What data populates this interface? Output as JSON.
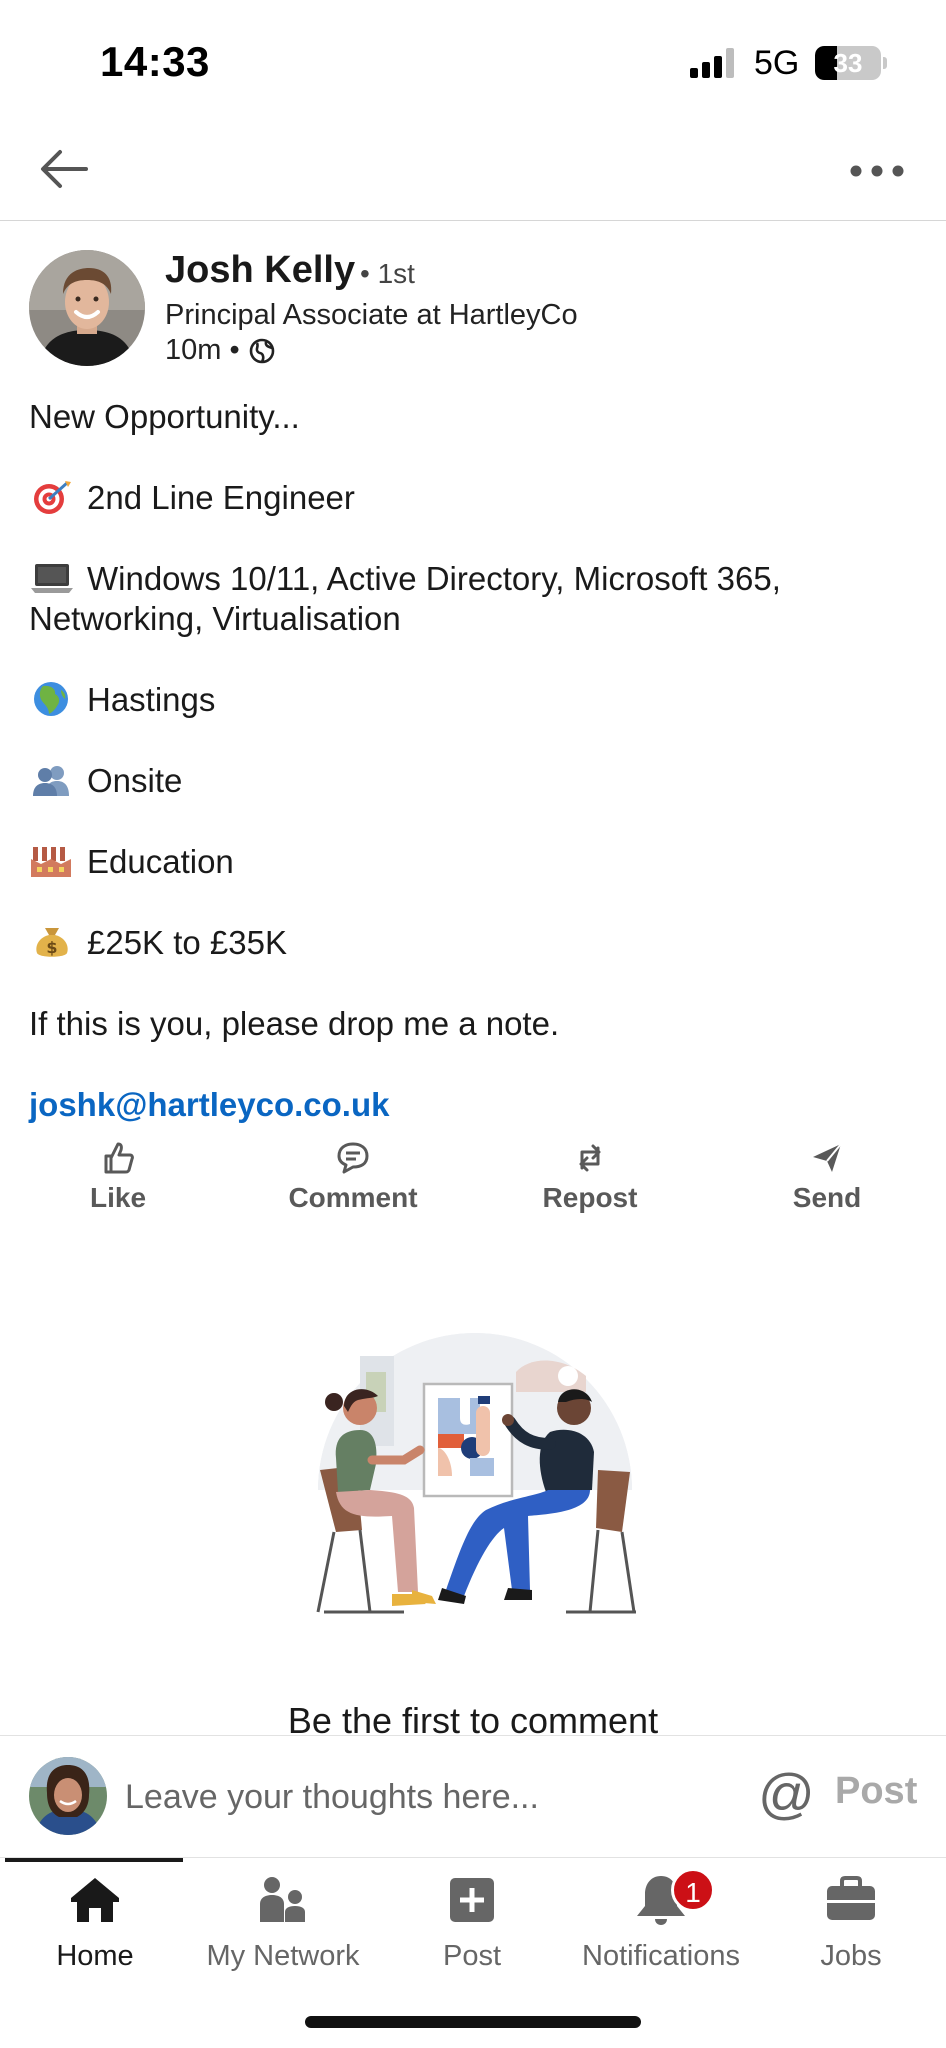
{
  "status_bar": {
    "time": "14:33",
    "network": "5G",
    "battery": "33",
    "battery_level": 0.33
  },
  "nav": {
    "back_icon": "arrow-left-icon",
    "more_icon": "ellipsis-icon"
  },
  "post": {
    "author": {
      "name": "Josh Kelly",
      "degree": "• 1st",
      "headline": "Principal Associate at HartleyCo",
      "time": "10m •",
      "visibility_icon": "globe-icon"
    },
    "lines": {
      "intro": "New Opportunity...",
      "role": "2nd Line Engineer",
      "skills_1": "Windows 10/11, Active Directory, Microsoft 365,",
      "skills_2": "Networking, Virtualisation",
      "location": "Hastings",
      "work_type": "Onsite",
      "sector": "Education",
      "salary": "£25K to £35K",
      "cta": "If this is you, please drop me a note.",
      "email": "joshk@hartleyco.co.uk"
    },
    "emojis": [
      "direct-hit-emoji",
      "laptop-emoji",
      "globe-africa-emoji",
      "busts-emoji",
      "factory-emoji",
      "money-bag-emoji"
    ]
  },
  "actions": {
    "like": "Like",
    "comment": "Comment",
    "repost": "Repost",
    "send": "Send"
  },
  "empty_state": {
    "text": "Be the first to comment"
  },
  "comment_bar": {
    "placeholder": "Leave your thoughts here...",
    "mention": "@",
    "post": "Post"
  },
  "tabs": [
    {
      "label": "Home",
      "icon": "home-icon",
      "active": true
    },
    {
      "label": "My Network",
      "icon": "people-icon"
    },
    {
      "label": "Post",
      "icon": "plus-box-icon"
    },
    {
      "label": "Notifications",
      "icon": "bell-icon",
      "badge": "1"
    },
    {
      "label": "Jobs",
      "icon": "briefcase-icon"
    }
  ],
  "colors": {
    "link": "#0a66c2",
    "badge": "#cc1016",
    "icon_gray": "#666666"
  }
}
